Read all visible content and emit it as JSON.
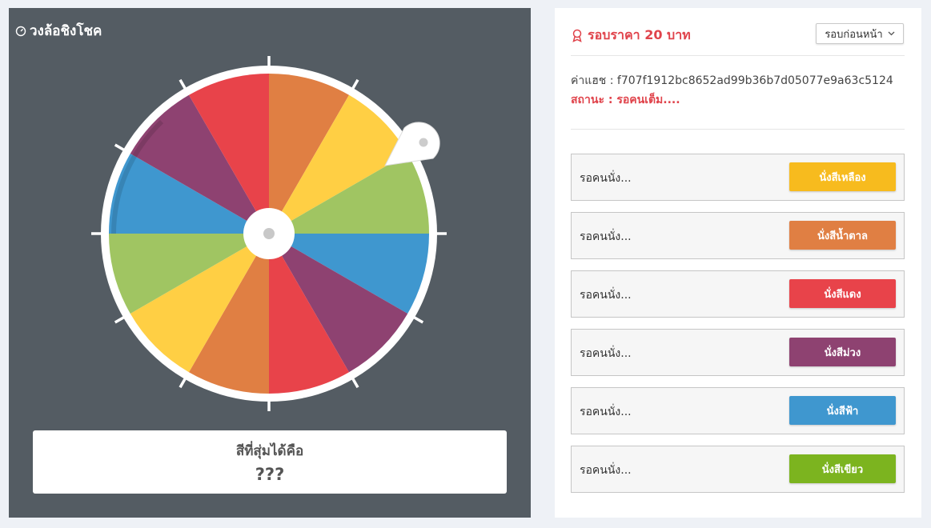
{
  "wheel": {
    "title": "วงล้อชิงโชค",
    "result_label": "สีที่สุ่มได้คือ",
    "result_value": "???",
    "segment_colors": [
      "#e07f43",
      "#ffcf44",
      "#a0c562",
      "#a0c562",
      "#3f97cf",
      "#8e4271",
      "#e8434a",
      "#e07f43",
      "#ffcf44",
      "#a0c562",
      "#3f97cf",
      "#8e4271",
      "#e8434a"
    ]
  },
  "round": {
    "title": "รอบราคา 20 บาท",
    "prev_button": "รอบก่อนหน้า",
    "hash_label": "ค่าแฮช : f707f1912bc8652ad99b36b7d05077e9a63c5124",
    "status": "สถานะ : รอคนเต็ม...."
  },
  "seats": [
    {
      "status": "รอคนนั่ง...",
      "button": "นั่งสีเหลือง",
      "color": "#f7bb1e"
    },
    {
      "status": "รอคนนั่ง...",
      "button": "นั่งสีน้ำตาล",
      "color": "#e07f43"
    },
    {
      "status": "รอคนนั่ง...",
      "button": "นั่งสีแดง",
      "color": "#e8434a"
    },
    {
      "status": "รอคนนั่ง...",
      "button": "นั่งสีม่วง",
      "color": "#8e4271"
    },
    {
      "status": "รอคนนั่ง...",
      "button": "นั่งสีฟ้า",
      "color": "#3f97cf"
    },
    {
      "status": "รอคนนั่ง...",
      "button": "นั่งสีเขียว",
      "color": "#7cb41f"
    }
  ]
}
